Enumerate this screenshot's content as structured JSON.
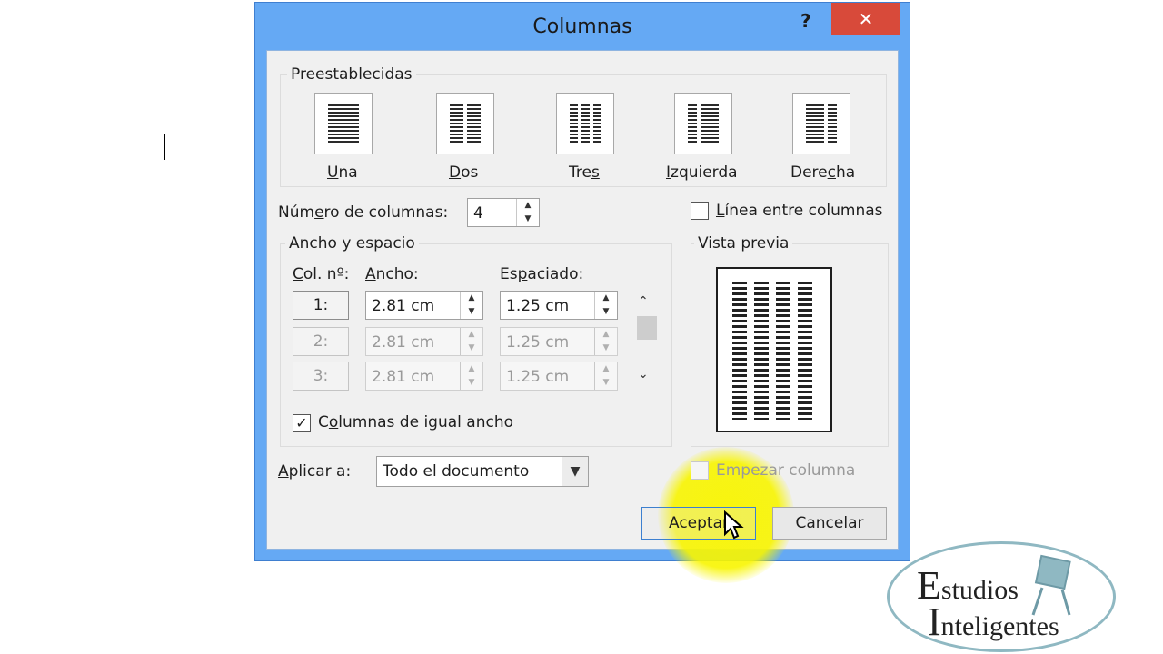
{
  "dialog": {
    "title": "Columnas",
    "help": "?",
    "close": "✕"
  },
  "presets": {
    "legend": "Preestablecidas",
    "items": [
      {
        "label_pre": "",
        "label_u": "U",
        "label_post": "na"
      },
      {
        "label_pre": "",
        "label_u": "D",
        "label_post": "os"
      },
      {
        "label_pre": "Tre",
        "label_u": "s",
        "label_post": ""
      },
      {
        "label_pre": "",
        "label_u": "I",
        "label_post": "zquierda"
      },
      {
        "label_pre": "Dere",
        "label_u": "c",
        "label_post": "ha"
      }
    ]
  },
  "num_columns": {
    "label_pre": "Núm",
    "label_u": "e",
    "label_post": "ro de columnas:",
    "value": "4"
  },
  "line_between": {
    "label_u": "L",
    "label_post": "ínea entre columnas",
    "checked": false
  },
  "width_spacing": {
    "legend": "Ancho y espacio",
    "col_header_u": "C",
    "col_header_post": "ol. nº:",
    "width_header_u": "A",
    "width_header_post": "ncho:",
    "spacing_header_pre": "Es",
    "spacing_header_u": "p",
    "spacing_header_post": "aciado:",
    "rows": [
      {
        "col": "1:",
        "width": "2.81 cm",
        "spacing": "1.25 cm",
        "enabled": true
      },
      {
        "col": "2:",
        "width": "2.81 cm",
        "spacing": "1.25 cm",
        "enabled": false
      },
      {
        "col": "3:",
        "width": "2.81 cm",
        "spacing": "1.25 cm",
        "enabled": false
      }
    ],
    "equal_width": {
      "label_pre": "C",
      "label_u": "o",
      "label_post": "lumnas de igual ancho",
      "checked": true
    }
  },
  "preview": {
    "legend": "Vista previa",
    "columns": 4
  },
  "apply_to": {
    "label_u": "A",
    "label_post": "plicar a:",
    "value": "Todo el documento"
  },
  "start_column": {
    "label": "Empezar columna",
    "checked": false
  },
  "buttons": {
    "ok": "Aceptar",
    "cancel": "Cancelar"
  },
  "watermark": {
    "line1_initial": "E",
    "line1_rest": "studios",
    "line2_initial": "I",
    "line2_rest": "nteligentes"
  },
  "colors": {
    "title_bar": "#65a9f4",
    "close_button": "#d84a3a",
    "cursor_highlight": "#f8f500"
  }
}
